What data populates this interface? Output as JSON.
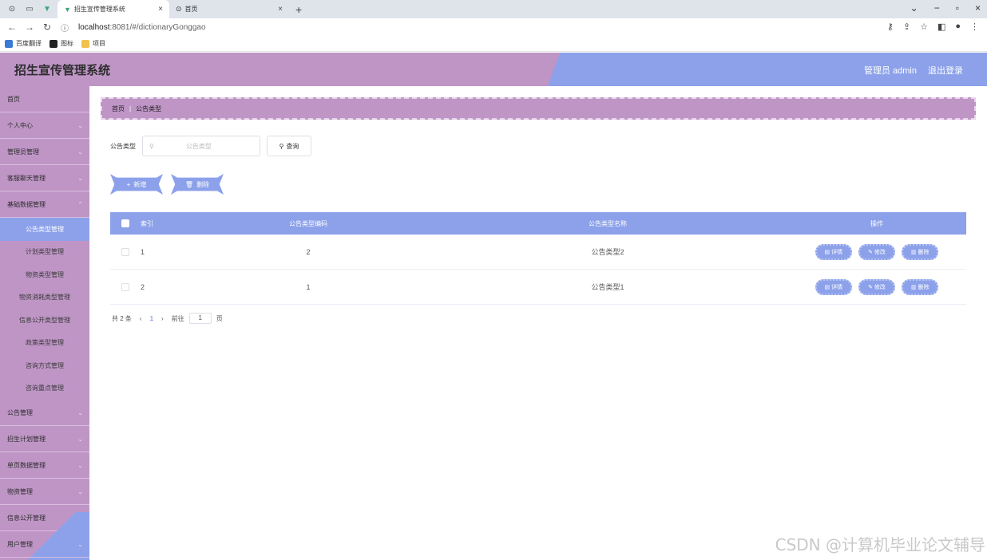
{
  "browser": {
    "tabs": [
      {
        "label": "招生宣传管理系统",
        "active": true
      },
      {
        "label": "首页",
        "active": false
      }
    ],
    "url_host": "localhost",
    "url_path": ":8081/#/dictionaryGonggao",
    "bookmarks": [
      "百度翻译",
      "图标",
      "项目"
    ]
  },
  "header": {
    "title": "招生宣传管理系统",
    "user": "管理员 admin",
    "logout": "退出登录"
  },
  "sidebar": {
    "menu_top": [
      {
        "label": "首页",
        "expand": false
      },
      {
        "label": "个人中心",
        "expand": true
      },
      {
        "label": "管理员管理",
        "expand": true
      },
      {
        "label": "客服聊天管理",
        "expand": true
      },
      {
        "label": "基础数据管理",
        "expand": true
      }
    ],
    "sub_items": [
      {
        "label": "公告类型管理",
        "active": true
      },
      {
        "label": "计划类型管理"
      },
      {
        "label": "物资类型管理"
      },
      {
        "label": "物资消耗类型管理"
      },
      {
        "label": "信息公开类型管理"
      },
      {
        "label": "政策类型管理"
      },
      {
        "label": "咨询方式管理"
      },
      {
        "label": "咨询重点管理"
      }
    ],
    "menu_bottom": [
      {
        "label": "公告管理"
      },
      {
        "label": "招生计划管理"
      },
      {
        "label": "单页数据管理"
      },
      {
        "label": "物资管理"
      },
      {
        "label": "信息公开管理"
      },
      {
        "label": "用户管理"
      }
    ]
  },
  "breadcrumb": {
    "home": "首页",
    "current": "公告类型"
  },
  "search": {
    "label": "公告类型",
    "placeholder": "公告类型",
    "button": "查询"
  },
  "actions": {
    "add": "新增",
    "delete": "删除"
  },
  "table": {
    "headers": {
      "index": "索引",
      "code": "公告类型编码",
      "name": "公告类型名称",
      "ops": "操作"
    },
    "rows": [
      {
        "index": "1",
        "code": "2",
        "name": "公告类型2"
      },
      {
        "index": "2",
        "code": "1",
        "name": "公告类型1"
      }
    ],
    "op_labels": {
      "detail": "详情",
      "edit": "修改",
      "delete": "删除"
    }
  },
  "pager": {
    "total": "共 2 条",
    "current": "1",
    "goto": "前往",
    "page_input": "1",
    "page_unit": "页"
  },
  "watermark": "CSDN @计算机毕业论文辅导"
}
